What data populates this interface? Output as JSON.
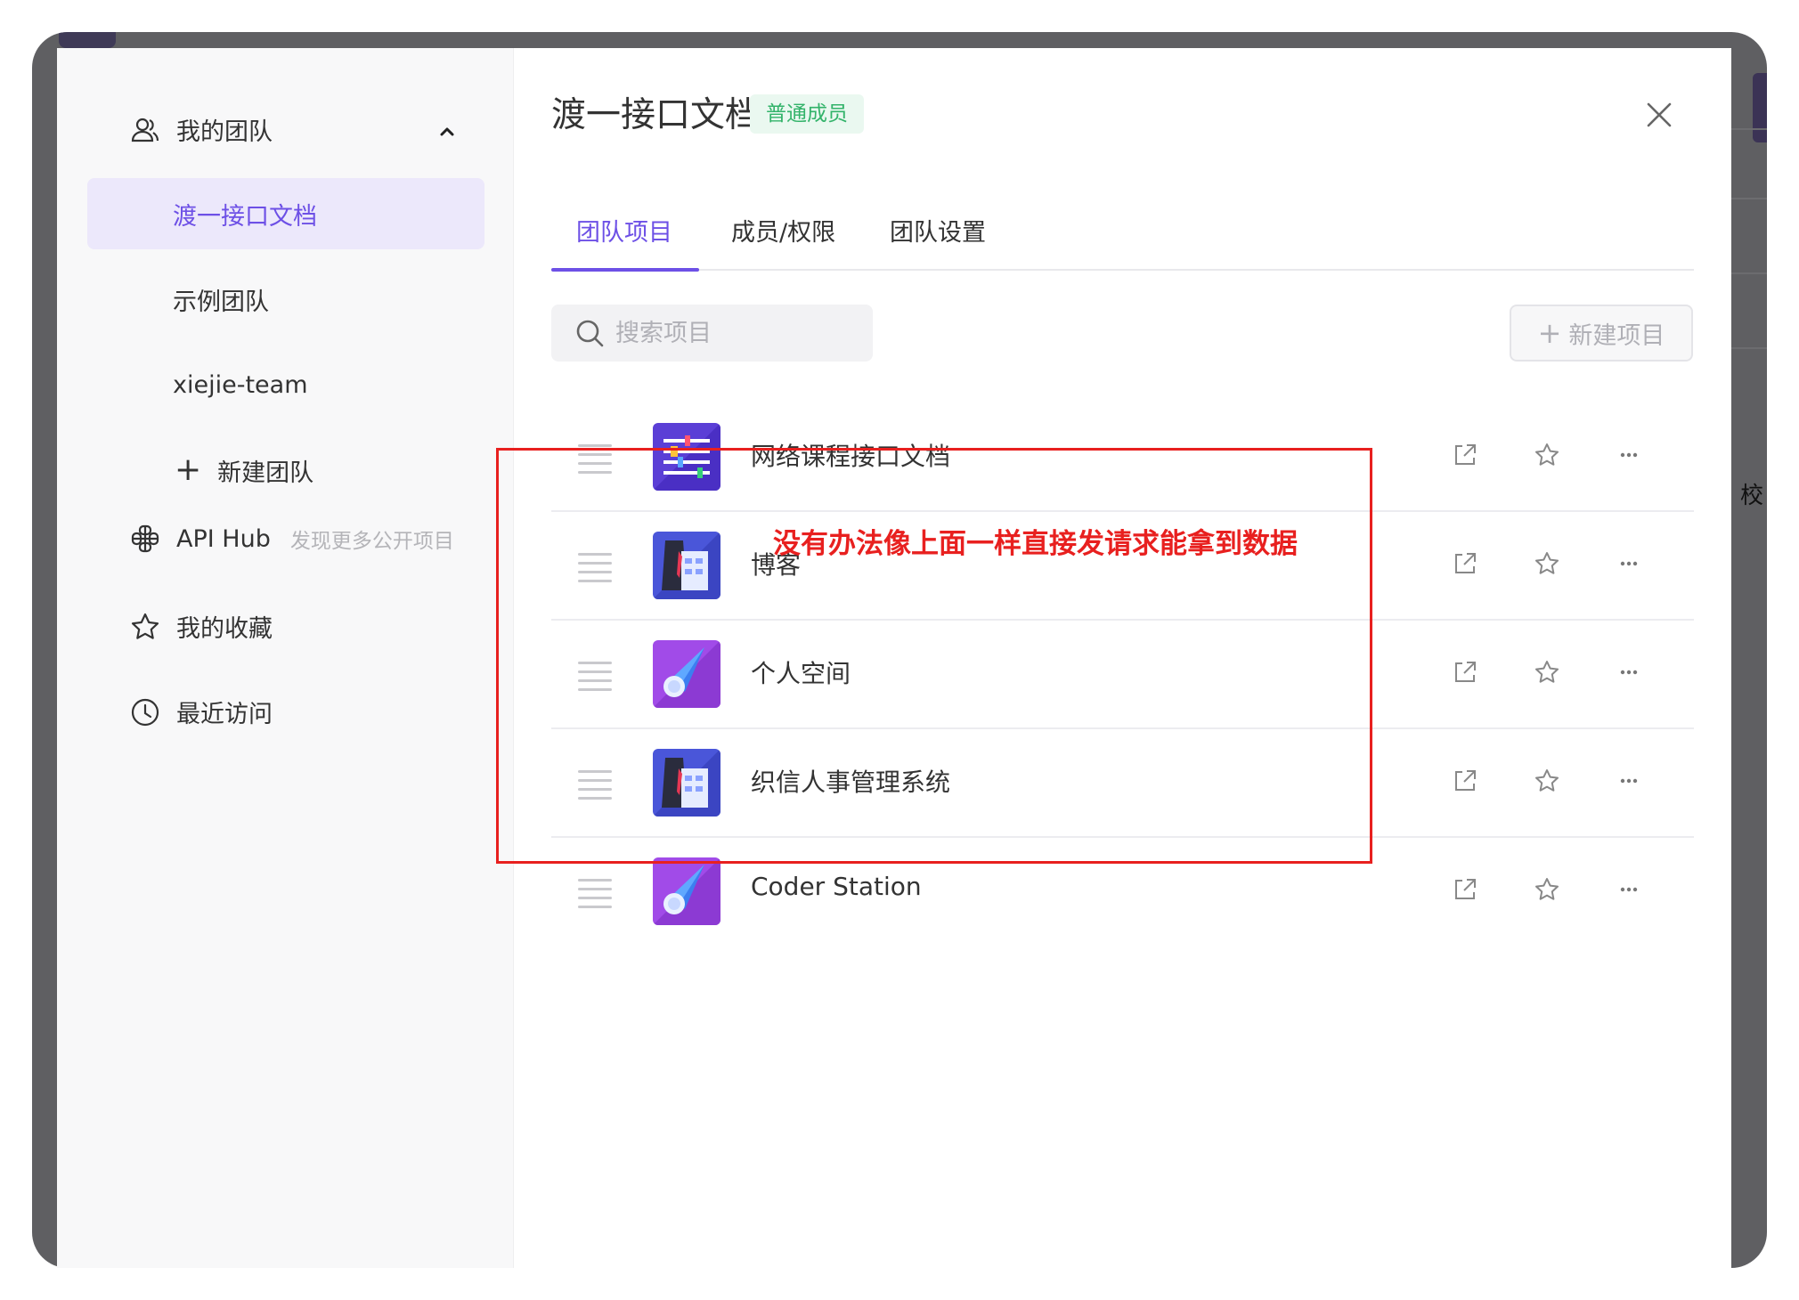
{
  "sidebar": {
    "my_team_label": "我的团队",
    "teams": [
      {
        "label": "渡一接口文档",
        "active": true
      },
      {
        "label": "示例团队",
        "active": false
      },
      {
        "label": "xiejie-team",
        "active": false
      }
    ],
    "new_team_label": "新建团队",
    "api_hub_label": "API Hub",
    "api_hub_desc": "发现更多公开项目",
    "favorites_label": "我的收藏",
    "recent_label": "最近访问"
  },
  "header": {
    "title": "渡一接口文档",
    "role_badge": "普通成员"
  },
  "tabs": [
    {
      "label": "团队项目",
      "active": true
    },
    {
      "label": "成员/权限",
      "active": false
    },
    {
      "label": "团队设置",
      "active": false
    }
  ],
  "search": {
    "placeholder": "搜索项目",
    "value": ""
  },
  "new_project_label": "新建项目",
  "projects": [
    {
      "name": "网络课程接口文档",
      "icon": "doc-list-icon"
    },
    {
      "name": "博客",
      "icon": "shirt-tie-icon"
    },
    {
      "name": "个人空间",
      "icon": "comet-icon"
    },
    {
      "name": "织信人事管理系统",
      "icon": "shirt-tie-icon"
    },
    {
      "name": "Coder Station",
      "icon": "comet-icon"
    }
  ],
  "annotation": {
    "text": "没有办法像上面一样直接发请求能拿到数据",
    "color": "#e8201f"
  },
  "background_text": "校",
  "colors": {
    "accent": "#6d50e6",
    "badge_bg": "#eaf8f0",
    "badge_text": "#33b36a"
  }
}
